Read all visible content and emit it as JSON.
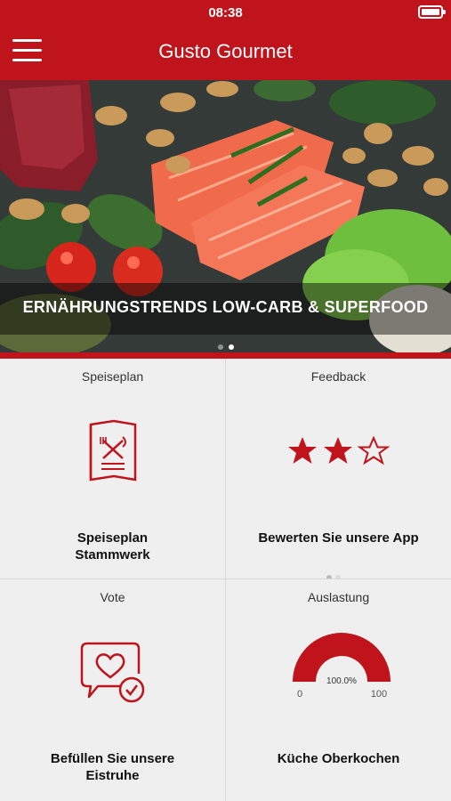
{
  "status_bar": {
    "time": "08:38"
  },
  "app_bar": {
    "title": "Gusto Gourmet"
  },
  "banner": {
    "caption": "ERNÄHRUNGSTRENDS LOW-CARB & SUPERFOOD",
    "page_count": 2,
    "active_page": 2
  },
  "tiles": {
    "speiseplan": {
      "label": "Speiseplan",
      "caption_line1": "Speiseplan",
      "caption_line2": "Stammwerk"
    },
    "feedback": {
      "label": "Feedback",
      "caption": "Bewerten Sie unsere App",
      "rating_filled": 2,
      "rating_max": 3,
      "page_count": 2,
      "active_page": 1
    },
    "vote": {
      "label": "Vote",
      "caption_line1": "Befüllen Sie unsere",
      "caption_line2": "Eistruhe"
    },
    "auslastung": {
      "label": "Auslastung",
      "caption": "Küche Oberkochen",
      "value_text": "100.0%",
      "min": "0",
      "max": "100",
      "value": 100
    }
  },
  "colors": {
    "brand_red": "#c0141c",
    "tile_bg": "#efefef"
  },
  "icons": [
    "menu-icon",
    "battery-icon",
    "menu-card-icon",
    "star-icon",
    "heart-chat-icon",
    "gauge-icon"
  ]
}
